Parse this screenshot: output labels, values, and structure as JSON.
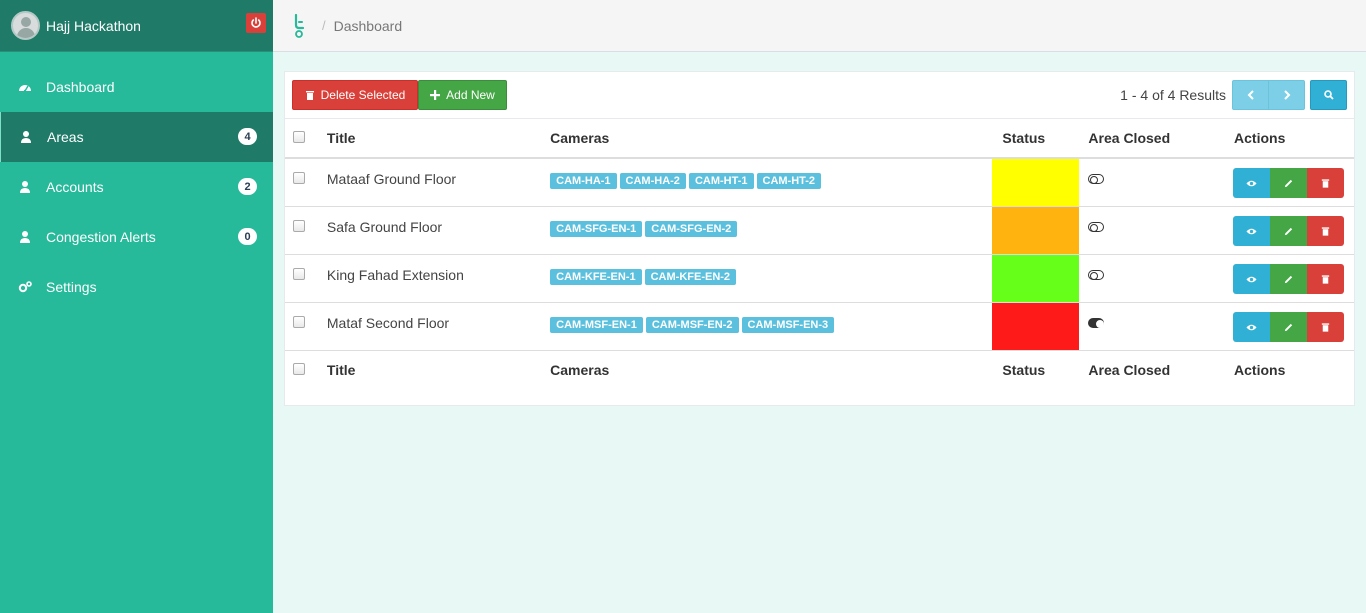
{
  "sidebar": {
    "title": "Hajj Hackathon",
    "items": [
      {
        "label": "Dashboard",
        "icon": "dashboard-icon",
        "badge": null
      },
      {
        "label": "Areas",
        "icon": "user-icon",
        "badge": "4"
      },
      {
        "label": "Accounts",
        "icon": "user-icon",
        "badge": "2"
      },
      {
        "label": "Congestion Alerts",
        "icon": "user-icon",
        "badge": "0"
      },
      {
        "label": "Settings",
        "icon": "cogs-icon",
        "badge": null
      }
    ]
  },
  "topbar": {
    "separator": "/",
    "breadcrumb": "Dashboard"
  },
  "toolbar": {
    "delete_label": "Delete Selected",
    "add_label": "Add New",
    "results": "1 - 4 of 4 Results"
  },
  "table": {
    "headers": {
      "title": "Title",
      "cameras": "Cameras",
      "status": "Status",
      "area_closed": "Area Closed",
      "actions": "Actions"
    },
    "rows": [
      {
        "title": "Mataaf Ground Floor",
        "cameras": [
          "CAM-HA-1",
          "CAM-HA-2",
          "CAM-HT-1",
          "CAM-HT-2"
        ],
        "status_color": "#ffff00",
        "closed": false
      },
      {
        "title": "Safa Ground Floor",
        "cameras": [
          "CAM-SFG-EN-1",
          "CAM-SFG-EN-2"
        ],
        "status_color": "#ffb30f",
        "closed": false
      },
      {
        "title": "King Fahad Extension",
        "cameras": [
          "CAM-KFE-EN-1",
          "CAM-KFE-EN-2"
        ],
        "status_color": "#66ff1a",
        "closed": false
      },
      {
        "title": "Mataf Second Floor",
        "cameras": [
          "CAM-MSF-EN-1",
          "CAM-MSF-EN-2",
          "CAM-MSF-EN-3"
        ],
        "status_color": "#ff1a1a",
        "closed": true
      }
    ]
  },
  "colors": {
    "sidebar_bg": "#26b99a",
    "sidebar_active": "#1f7a68",
    "danger": "#d9403a",
    "success": "#45a645",
    "info": "#31b0d5"
  }
}
